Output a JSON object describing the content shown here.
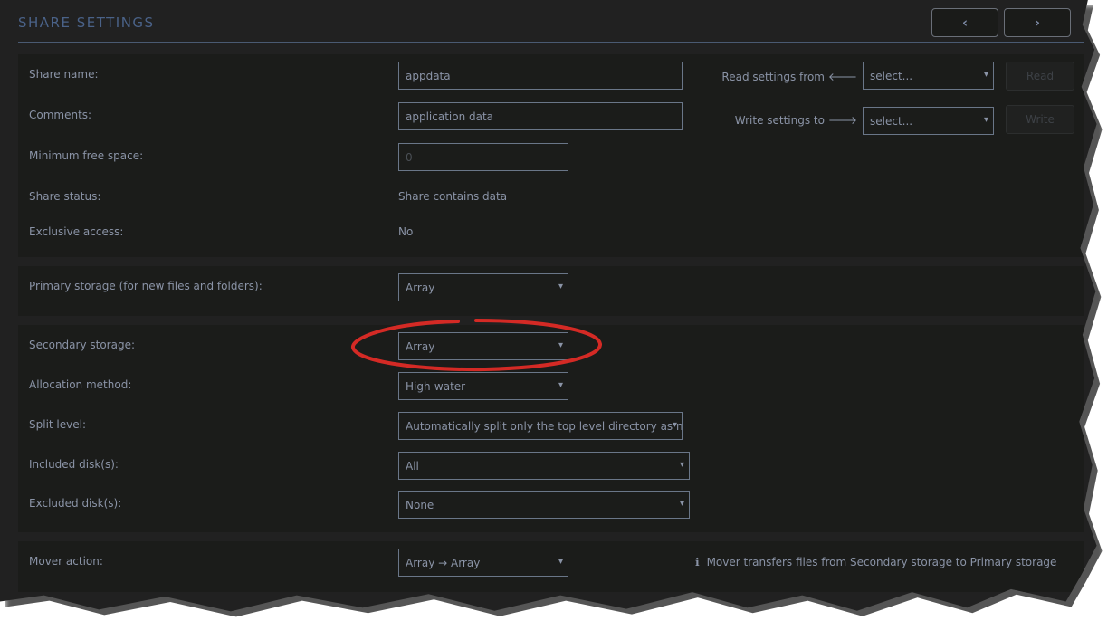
{
  "header": {
    "title": "SHARE SETTINGS",
    "prev_icon": "‹",
    "next_icon": "›"
  },
  "general": {
    "share_name_label": "Share name:",
    "share_name_value": "appdata",
    "comments_label": "Comments:",
    "comments_value": "application data",
    "min_free_label": "Minimum free space:",
    "min_free_placeholder": "0",
    "status_label": "Share status:",
    "status_value": "Share contains data",
    "exclusive_label": "Exclusive access:",
    "exclusive_value": "No",
    "read_from_label": "Read settings from",
    "read_from_arrow": "🡐",
    "read_from_value": "select...",
    "read_button": "Read",
    "write_to_label": "Write settings to",
    "write_to_arrow": "🡒",
    "write_to_value": "select...",
    "write_button": "Write"
  },
  "primary": {
    "label": "Primary storage (for new files and folders):",
    "value": "Array"
  },
  "secondary": {
    "label": "Secondary storage:",
    "value": "Array",
    "allocation_label": "Allocation method:",
    "allocation_value": "High-water",
    "split_label": "Split level:",
    "split_value": "Automatically split only the top level directory as n",
    "included_label": "Included disk(s):",
    "included_value": "All",
    "excluded_label": "Excluded disk(s):",
    "excluded_value": "None"
  },
  "mover": {
    "label": "Mover action:",
    "value": "Array → Array",
    "info_icon": "ℹ",
    "info_text": "Mover transfers files from Secondary storage to Primary storage"
  },
  "annotation_color": "#d42a25"
}
